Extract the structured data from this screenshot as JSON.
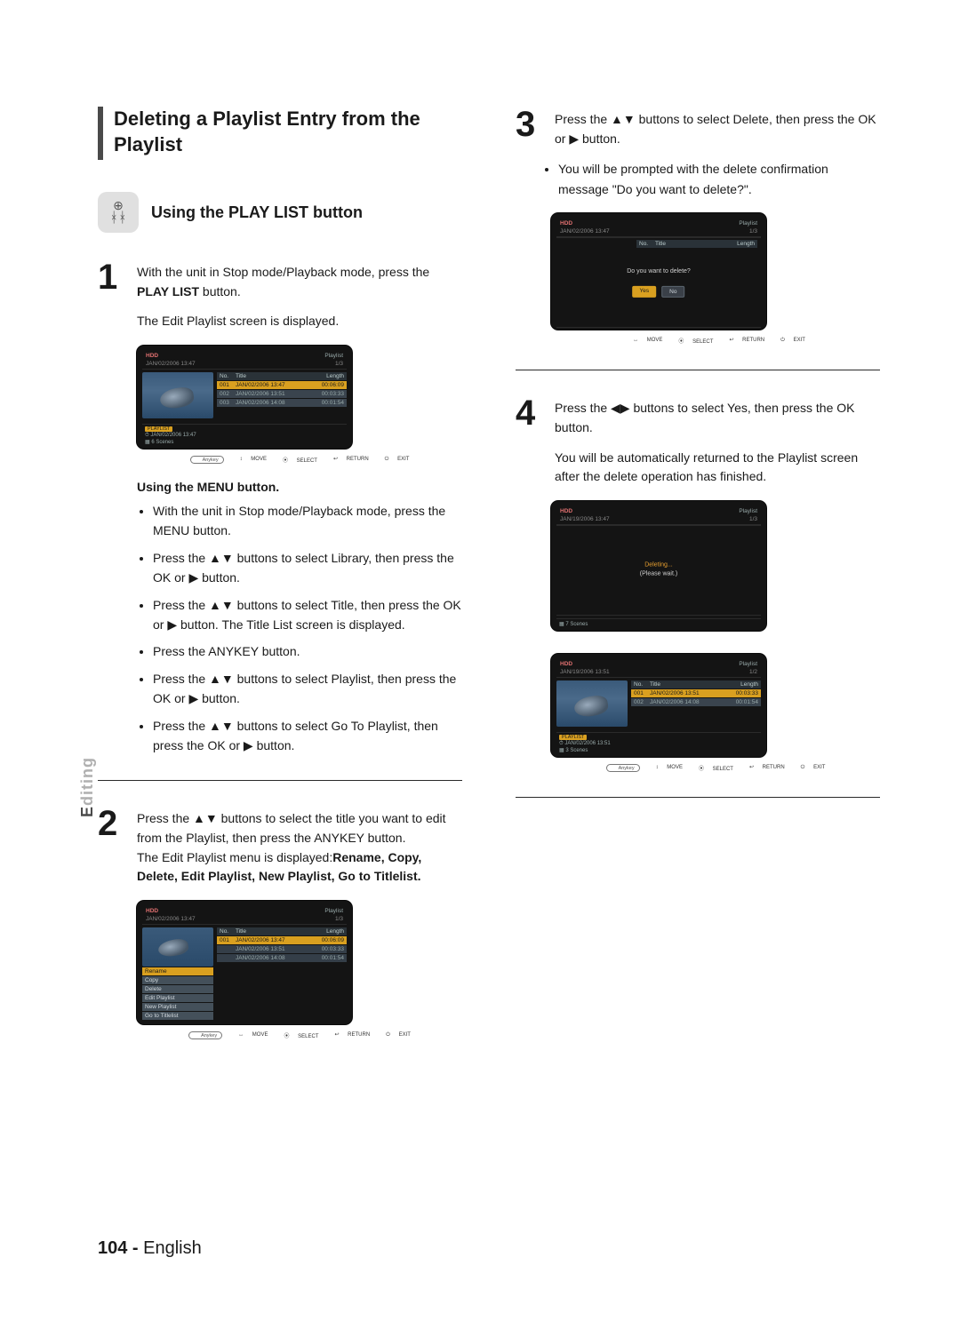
{
  "section_title": "Deleting a Playlist Entry from the Playlist",
  "subtitle": "Using the PLAY LIST button",
  "hdd_badge": {
    "top": "⊕",
    "bottom": "ᚼᚼ"
  },
  "steps": {
    "s1": {
      "num": "1",
      "text": "With the unit in Stop mode/Playback mode, press the ",
      "bold": "PLAY LIST",
      "text2": " button.",
      "after": "The Edit Playlist screen is displayed."
    },
    "menu_subhead": "Using the MENU button.",
    "menu_items": [
      "With the unit in Stop mode/Playback mode, press the MENU button.",
      "Press the ▲▼ buttons to select Library, then press the OK or ▶ button.",
      "Press the ▲▼ buttons to select Title, then press the OK or ▶ button. The Title List screen is displayed.",
      "Press the ANYKEY button.",
      "Press the ▲▼ buttons to select Playlist, then press the OK or ▶ button.",
      "Press the ▲▼ buttons to select Go To Playlist, then press the OK or ▶ button."
    ],
    "s2": {
      "num": "2",
      "line1": "Press the ▲▼ buttons to select the title you want to edit from the Playlist, then press the ANYKEY button.",
      "line2": "The Edit Playlist menu is displayed:",
      "line3": "Rename, Copy, Delete, Edit Playlist, New Playlist, Go to Titlelist."
    },
    "s3": {
      "num": "3",
      "line1": "Press the ▲▼ buttons to select Delete, then press the OK or ▶ button.",
      "bullet": "You will be prompted with the delete confirmation message \"Do you want to delete?\"."
    },
    "s4": {
      "num": "4",
      "line1": "Press the ◀▶ buttons to select Yes, then press the OK button.",
      "after": "You will be automatically returned to the Playlist screen after the delete operation has finished."
    }
  },
  "osd": {
    "hdd": "HDD",
    "playlist": "Playlist",
    "datetime1": "JAN/02/2006 13:47",
    "datetime2": "JAN/19/2006 13:47",
    "datetime3": "JAN/19/2006 13:51",
    "page13": "1/3",
    "page12": "1/2",
    "cols": {
      "no": "No.",
      "title": "Title",
      "length": "Length"
    },
    "rows": [
      {
        "no": "001",
        "title": "JAN/02/2006 13:47",
        "len": "00:06:09"
      },
      {
        "no": "002",
        "title": "JAN/02/2006 13:51",
        "len": "00:03:33"
      },
      {
        "no": "003",
        "title": "JAN/02/2006 14:08",
        "len": "00:01:54"
      }
    ],
    "rows2": [
      {
        "no": "001",
        "title": "JAN/02/2006 13:51",
        "len": "00:03:33"
      },
      {
        "no": "002",
        "title": "JAN/02/2006 14:08",
        "len": "00:01:54"
      }
    ],
    "info_tag": "PLAYLIST",
    "info_date": "JAN/02/2006 13:47",
    "info_date2": "JAN/02/2006 13:51",
    "info_scenes": "6 Scenes",
    "info_scenes2": "7 Scenes",
    "info_scenes3": "3 Scenes",
    "nav": {
      "anykey": "Anykey",
      "move": "MOVE",
      "select": "SELECT",
      "return": "RETURN",
      "exit": "EXIT"
    },
    "context_menu": [
      "Rename",
      "Copy",
      "Delete",
      "Edit Playlist",
      "New Playlist",
      "Go to Titlelist"
    ],
    "confirm_msg": "Do you want to delete?",
    "yes": "Yes",
    "no": "No",
    "deleting": "Deleting...",
    "please_wait": "(Please wait.)"
  },
  "side_tab": "Editing",
  "page_number_prefix": "104 - ",
  "page_number_lang": "English"
}
